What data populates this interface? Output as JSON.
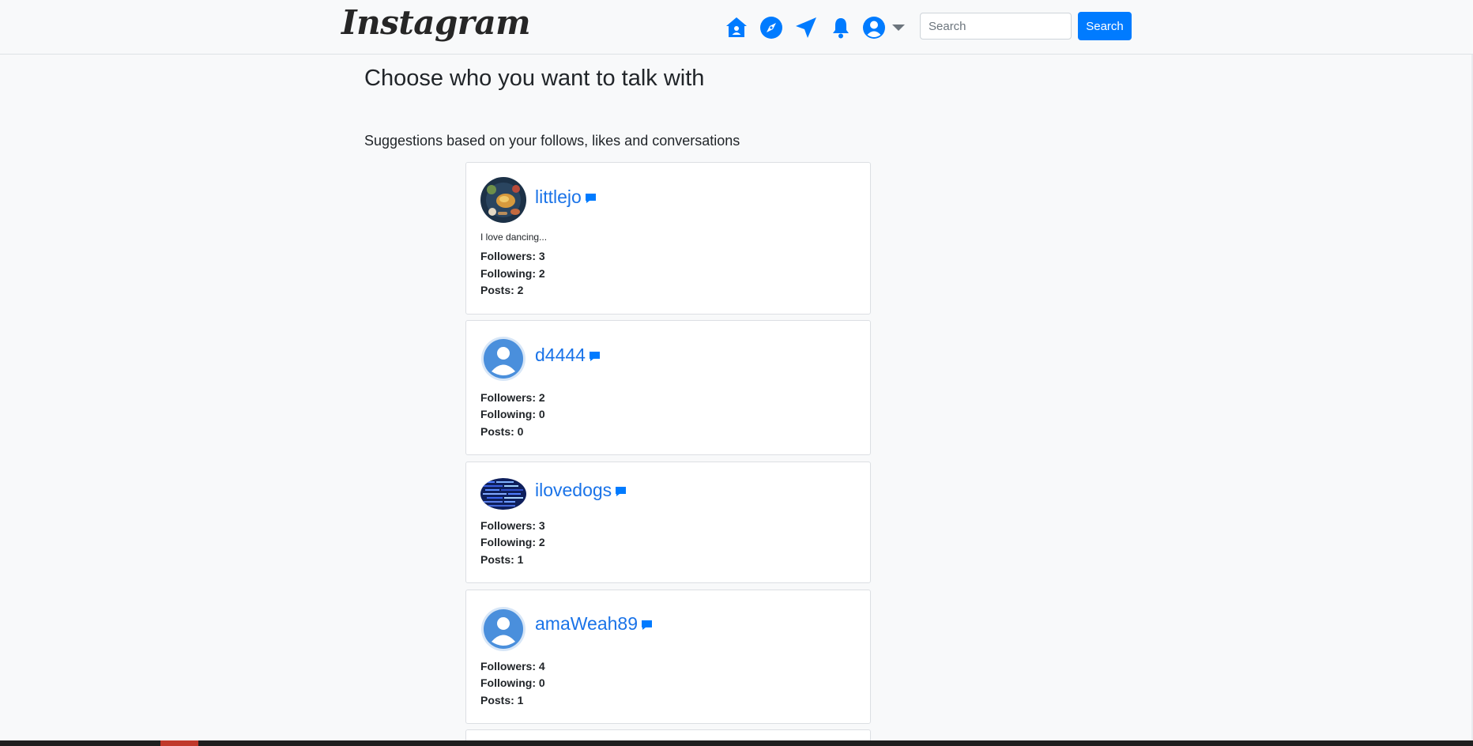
{
  "app": {
    "logo_text": "Instagram",
    "accent_color": "#007bff",
    "link_color": "#1a73e8"
  },
  "navbar": {
    "icons": [
      "home-icon",
      "compass-icon",
      "send-icon",
      "bell-icon",
      "user-avatar-icon",
      "dropdown-caret-icon"
    ],
    "search": {
      "placeholder": "Search",
      "value": ""
    },
    "search_button_label": "Search"
  },
  "main": {
    "title": "Choose who you want to talk with",
    "subtitle": "Suggestions based on your follows, likes and conversations",
    "users": [
      {
        "username": "littlejo",
        "bio": "I love dancing...",
        "avatar": "photo-food",
        "followers": "Followers: 3",
        "following": "Following: 2",
        "posts": "Posts: 2"
      },
      {
        "username": "d4444",
        "bio": "",
        "avatar": "default",
        "followers": "Followers: 2",
        "following": "Following: 0",
        "posts": "Posts: 0"
      },
      {
        "username": "ilovedogs",
        "bio": "",
        "avatar": "photo-code",
        "followers": "Followers: 3",
        "following": "Following: 2",
        "posts": "Posts: 1"
      },
      {
        "username": "amaWeah89",
        "bio": "",
        "avatar": "default",
        "followers": "Followers: 4",
        "following": "Following: 0",
        "posts": "Posts: 1"
      }
    ]
  }
}
